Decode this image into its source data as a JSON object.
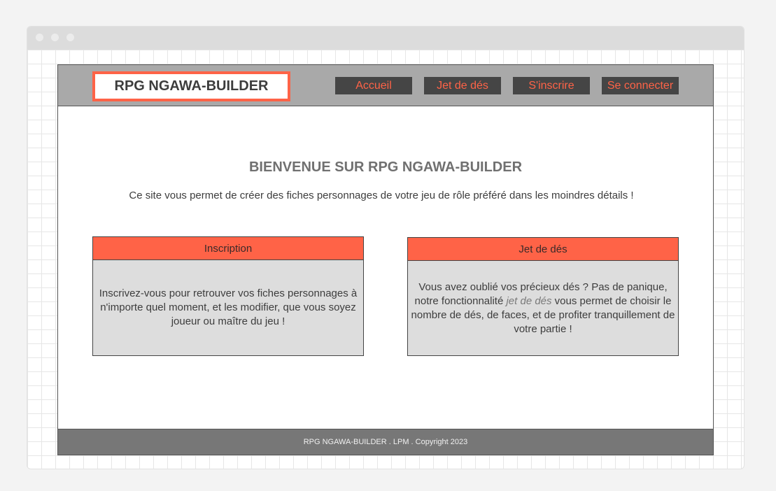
{
  "header": {
    "logo": "RPG NGAWA-BUILDER",
    "nav": [
      "Accueil",
      "Jet de dés",
      "S'inscrire",
      "Se connecter"
    ]
  },
  "welcome": {
    "title": "BIENVENUE SUR RPG NGAWA-BUILDER",
    "subtitle": "Ce site vous permet de créer des fiches personnages de votre jeu de rôle préféré dans les moindres détails !"
  },
  "cards": [
    {
      "title": "Inscription",
      "text": "Inscrivez-vous pour retrouver vos fiches personnages à n'importe quel moment, et les modifier, que vous soyez joueur ou maître du jeu !"
    },
    {
      "title": "Jet de dés",
      "text_before": "Vous avez oublié vos précieux dés ? Pas de panique, notre fonctionnalité ",
      "text_em": "jet de dés",
      "text_after": " vous permet de choisir le nombre de dés, de faces, et de profiter tranquillement de votre partie !"
    }
  ],
  "footer": {
    "text": "RPG NGAWA-BUILDER . LPM . Copyright 2023"
  },
  "colors": {
    "accent": "#ff6347",
    "header_bg": "#a9a9a9",
    "nav_bg": "#454545",
    "footer_bg": "#777777",
    "card_bg": "#dddddd"
  }
}
